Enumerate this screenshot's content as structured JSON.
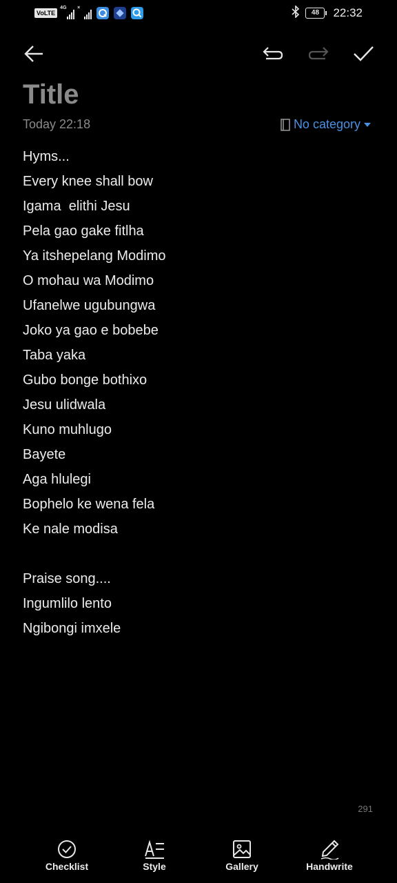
{
  "status_bar": {
    "volte": "VoLTE",
    "network": "4G",
    "battery": "48",
    "time": "22:32"
  },
  "toolbar": {
    "back_icon": "arrow-left-icon",
    "undo_icon": "undo-icon",
    "redo_icon": "redo-icon",
    "save_icon": "check-icon"
  },
  "note": {
    "title": "Title",
    "date": "Today 22:18",
    "category": "No category",
    "lines": [
      "Hyms...",
      "Every knee shall bow",
      "Igama  elithi Jesu",
      "Pela gao gake fitlha",
      "Ya itshepelang Modimo",
      "O mohau wa Modimo",
      "Ufanelwe ugubungwa",
      "Joko ya gao e bobebe",
      "Taba yaka",
      "Gubo bonge bothixo",
      "Jesu ulidwala",
      "Kuno muhlugo",
      "Bayete",
      "Aga hlulegi",
      "Bophelo ke wena fela",
      "Ke nale modisa",
      "",
      "Praise song....",
      "Ingumlilo lento",
      "Ngibongi imxele"
    ],
    "char_count": "291"
  },
  "bottom_bar": {
    "checklist": "Checklist",
    "style": "Style",
    "gallery": "Gallery",
    "handwrite": "Handwrite"
  },
  "colors": {
    "background": "#000000",
    "text": "#ececec",
    "muted": "#8a8a8a",
    "accent": "#4a90e2"
  }
}
